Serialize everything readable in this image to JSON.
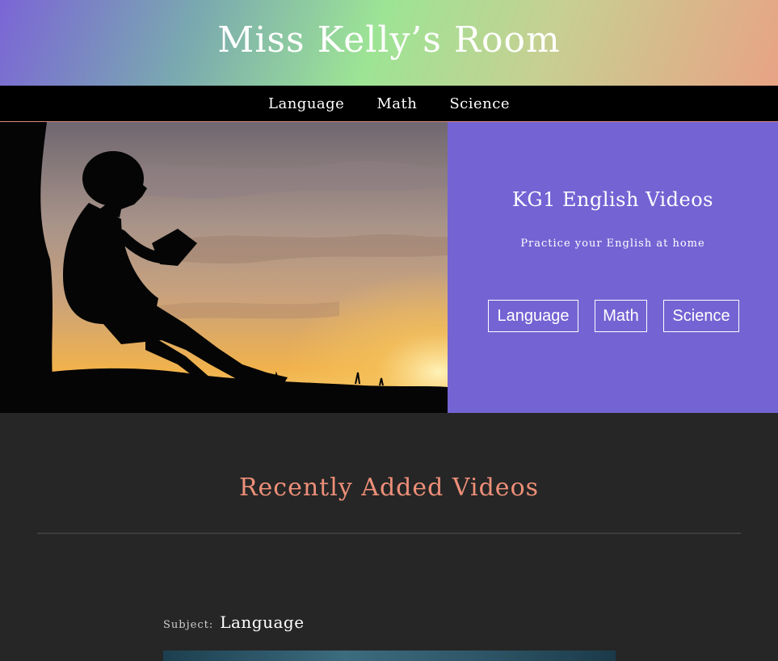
{
  "site": {
    "title": "Miss Kelly’s Room"
  },
  "nav": {
    "items": [
      "Language",
      "Math",
      "Science"
    ]
  },
  "hero": {
    "heading": "KG1 English Videos",
    "subheading": "Practice your English at home",
    "buttons": [
      "Language",
      "Math",
      "Science"
    ],
    "image": "child-reading-silhouette-sunset"
  },
  "recent": {
    "title": "Recently Added Videos",
    "subject_label": "Subject:",
    "subject_value": "Language"
  },
  "colors": {
    "header_gradient": [
      "#7b65d6",
      "#9de495",
      "#e8a385"
    ],
    "nav_bg": "#000000",
    "panel_bg": "#7463d3",
    "page_bg": "#262626",
    "accent_title": "#ee8f78"
  }
}
